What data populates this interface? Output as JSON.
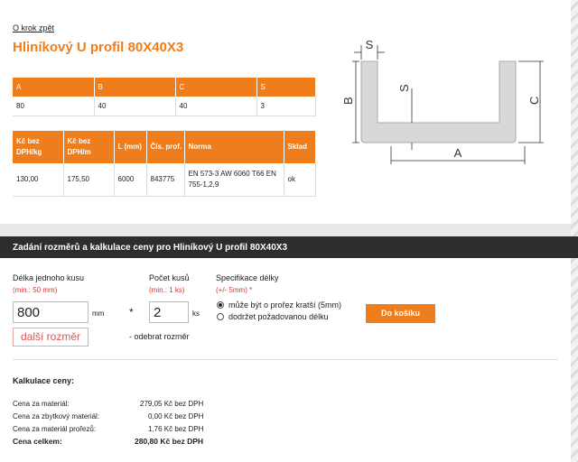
{
  "nav": {
    "back_label": "O krok zpět"
  },
  "product": {
    "title": "Hliníkový U profil 80X40X3"
  },
  "dims_table": {
    "headers": [
      "A",
      "B",
      "C",
      "S"
    ],
    "values": [
      "80",
      "40",
      "40",
      "3"
    ]
  },
  "price_table": {
    "headers": [
      "Kč bez DPH/kg",
      "Kč bez DPH/m",
      "L (mm)",
      "Čís. prof.",
      "Norma",
      "Sklad"
    ],
    "row": [
      "130,00",
      "175,50",
      "6000",
      "843775",
      "EN 573-3 AW 6060 T66 EN 755-1,2,9",
      "ok"
    ]
  },
  "diagram": {
    "labels": {
      "s_top": "S",
      "s_mid": "S",
      "b": "B",
      "c": "C",
      "a": "A"
    }
  },
  "calc_bar": {
    "title": "Zadání rozměrů a kalkulace ceny pro Hliníkový U profil 80X40X3"
  },
  "form": {
    "length_label": "Délka jednoho kusu",
    "length_hint": "(min.: 50 mm)",
    "length_value": "800",
    "length_unit": "mm",
    "times": "*",
    "count_label": "Počet kusů",
    "count_hint": "(min.: 1 ks)",
    "count_value": "2",
    "count_unit": "ks",
    "spec_label": "Specifikace délky",
    "spec_hint": "(+/- 5mm) *",
    "radio_1": "může být o prořez kratší (5mm)",
    "radio_2": "dodržet požadovanou délku",
    "cart_button": "Do košíku",
    "more_button": "další rozměr",
    "remove_link": "- odebrat rozměr"
  },
  "calc": {
    "heading": "Kalkulace ceny:",
    "rows": [
      {
        "label": "Cena za materiál:",
        "value": "279,05 Kč bez DPH"
      },
      {
        "label": "Cena za zbytkový materiál:",
        "value": "0,00 Kč bez DPH"
      },
      {
        "label": "Cena za materiál prořezů:",
        "value": "1,76 Kč bez DPH"
      },
      {
        "label": "Cena celkem:",
        "value": "280,80 Kč bez DPH"
      }
    ]
  },
  "colors": {
    "accent": "#f07d1c",
    "dark_bar": "#2d2d2d",
    "hint_red": "#d33333"
  }
}
